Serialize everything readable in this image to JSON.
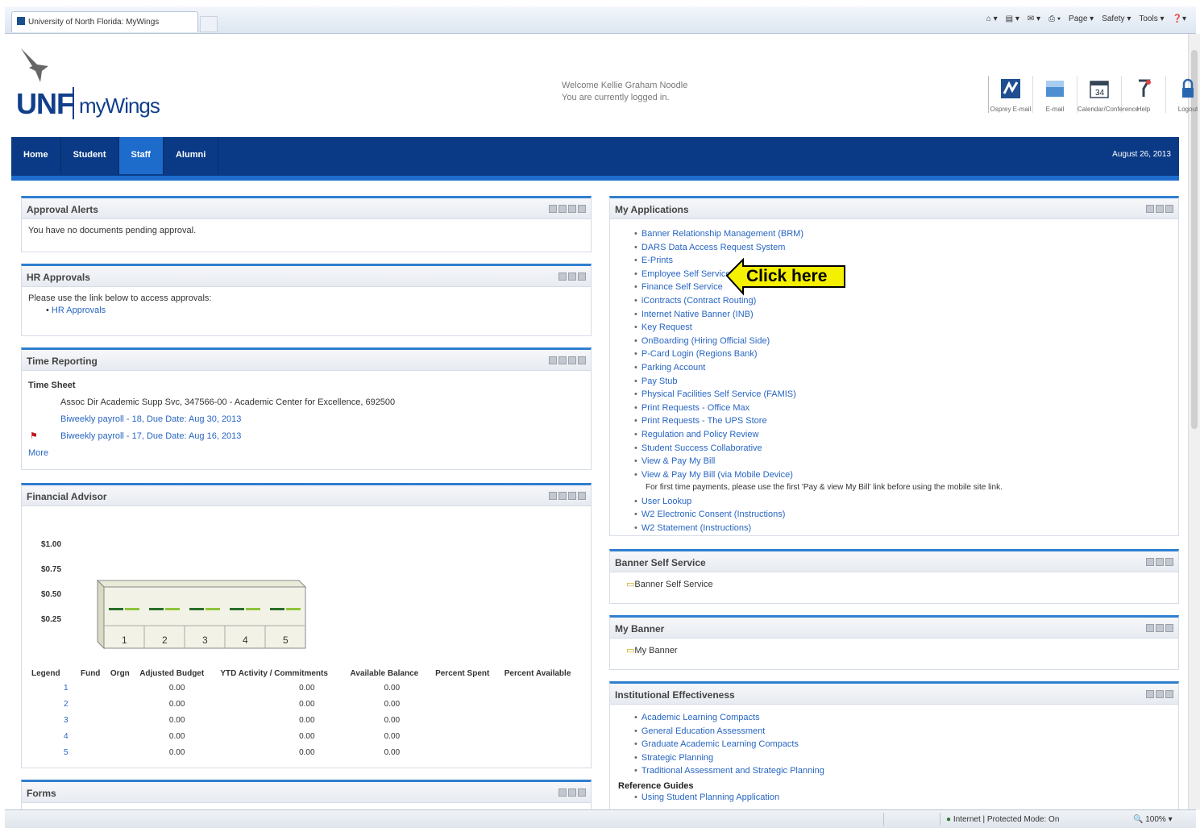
{
  "browser": {
    "tab_title": "University of North Florida: MyWings",
    "commands": [
      "Page ▾",
      "Safety ▾",
      "Tools ▾"
    ],
    "status_zone": "Internet | Protected Mode: On",
    "zoom": "100%"
  },
  "header": {
    "logo_unf": "UNF",
    "logo_mywings": "myWings",
    "welcome_line1": "Welcome Kellie Graham Noodle",
    "welcome_line2": "You are currently logged in.",
    "icons": [
      {
        "label": "Osprey E-mail",
        "icon": "mail-icon"
      },
      {
        "label": "E-mail",
        "icon": "outlook-icon"
      },
      {
        "label": "Calendar/Conference",
        "icon": "calendar-icon"
      },
      {
        "label": "Help",
        "icon": "help-icon"
      },
      {
        "label": "Logout",
        "icon": "lock-icon"
      }
    ]
  },
  "nav": {
    "tabs": [
      "Home",
      "Student",
      "Staff",
      "Alumni"
    ],
    "active": "Staff",
    "date": "August 26, 2013"
  },
  "approval_alerts": {
    "title": "Approval Alerts",
    "text": "You have no documents pending approval."
  },
  "hr_approvals": {
    "title": "HR Approvals",
    "text": "Please use the link below to access approvals:",
    "link": "HR Approvals"
  },
  "time_reporting": {
    "title": "Time Reporting",
    "subtitle": "Time Sheet",
    "position": "Assoc Dir Academic Supp Svc, 347566-00 - Academic Center for Excellence, 692500",
    "entries": [
      "Biweekly payroll - 18, Due Date: Aug 30, 2013",
      "Biweekly payroll - 17, Due Date: Aug 16, 2013"
    ],
    "more": "More"
  },
  "financial_advisor": {
    "title": "Financial Advisor",
    "columns": [
      "Legend",
      "Fund",
      "Orgn",
      "Adjusted Budget",
      "YTD Activity / Commitments",
      "Available Balance",
      "Percent Spent",
      "Percent Available"
    ],
    "rows": [
      {
        "legend": "1",
        "budget": "0.00",
        "ytd": "0.00",
        "available": "0.00"
      },
      {
        "legend": "2",
        "budget": "0.00",
        "ytd": "0.00",
        "available": "0.00"
      },
      {
        "legend": "3",
        "budget": "0.00",
        "ytd": "0.00",
        "available": "0.00"
      },
      {
        "legend": "4",
        "budget": "0.00",
        "ytd": "0.00",
        "available": "0.00"
      },
      {
        "legend": "5",
        "budget": "0.00",
        "ytd": "0.00",
        "available": "0.00"
      }
    ]
  },
  "chart_data": {
    "type": "bar",
    "categories": [
      "1",
      "2",
      "3",
      "4",
      "5"
    ],
    "series": [
      {
        "values": [
          0,
          0,
          0,
          0,
          0
        ],
        "color": "#2a6e2a"
      },
      {
        "values": [
          0,
          0,
          0,
          0,
          0
        ],
        "color": "#8fc43a"
      }
    ],
    "y_ticks": [
      "$1.00",
      "$0.75",
      "$0.50",
      "$0.25"
    ],
    "ylim": [
      0,
      1
    ]
  },
  "forms": {
    "title": "Forms"
  },
  "my_applications": {
    "title": "My Applications",
    "items": [
      "Banner Relationship Management (BRM)",
      "DARS Data Access Request System",
      "E-Prints",
      "Employee Self Service",
      "Finance Self Service",
      "iContracts (Contract Routing)",
      "Internet Native Banner (INB)",
      "Key Request",
      "OnBoarding (Hiring Official Side)",
      "P-Card Login (Regions Bank)",
      "Parking Account",
      "Pay Stub",
      "Physical Facilities Self Service (FAMIS)",
      "Print Requests - Office Max",
      "Print Requests - The UPS Store",
      "Regulation and Policy Review",
      "Student Success Collaborative",
      "View & Pay My Bill",
      "View & Pay My Bill (via Mobile Device)"
    ],
    "note": "For first time payments, please use the first 'Pay & view My Bill' link before using the mobile site link.",
    "items2": [
      "User Lookup",
      "W2 Electronic Consent (Instructions)",
      "W2 Statement (Instructions)"
    ],
    "callout": "Click here"
  },
  "banner_self_service": {
    "title": "Banner Self Service",
    "item": "Banner Self Service"
  },
  "my_banner": {
    "title": "My Banner",
    "item": "My Banner"
  },
  "institutional_effectiveness": {
    "title": "Institutional Effectiveness",
    "items": [
      "Academic Learning Compacts",
      "General Education Assessment",
      "Graduate Academic Learning Compacts",
      "Strategic Planning",
      "Traditional Assessment and Strategic Planning"
    ],
    "ref_title": "Reference Guides",
    "ref_item": "Using Student Planning Application"
  }
}
